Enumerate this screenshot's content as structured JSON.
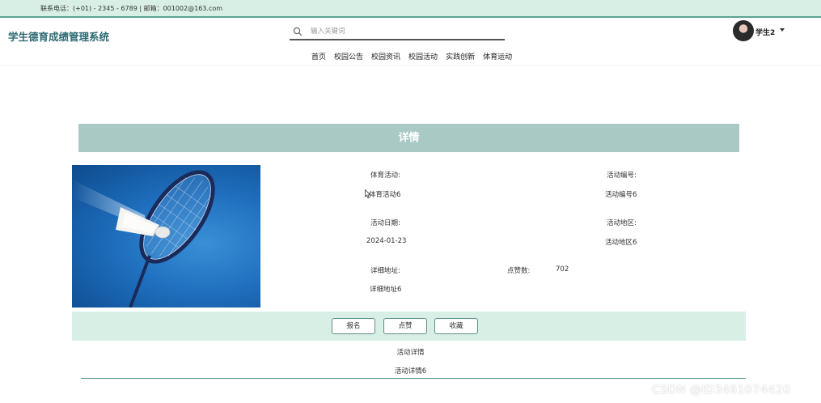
{
  "topbar": {
    "contact": "联系电话：(+01) - 2345 - 6789 | 邮箱：001002@163.com"
  },
  "header": {
    "site_title": "学生德育成绩管理系统",
    "search_placeholder": "输入关键词",
    "user_name": "学生2"
  },
  "nav": {
    "items": [
      "首页",
      "校园公告",
      "校园资讯",
      "校园活动",
      "实践创新",
      "体育运动"
    ]
  },
  "detail": {
    "title": "详情",
    "fields": {
      "sport_activity_label": "体育活动:",
      "sport_activity_value": "体育活动6",
      "activity_no_label": "活动编号:",
      "activity_no_value": "活动编号6",
      "activity_date_label": "活动日期:",
      "activity_date_value": "2024-01-23",
      "activity_area_label": "活动地区:",
      "activity_area_value": "活动地区6",
      "address_label": "详细地址:",
      "address_value": "详细地址6",
      "likes_label": "点赞数:",
      "likes_value": "702"
    },
    "buttons": {
      "signup": "报名",
      "like": "点赞",
      "favorite": "收藏"
    },
    "description_label": "活动详情",
    "description_value": "活动详情6"
  },
  "watermark": "CSDN @ID3461074420",
  "colors": {
    "topbar_bg": "#d8efe6",
    "accent": "#5aa590",
    "title_bar": "#a9c9c5",
    "site_title": "#2d6a74"
  },
  "icons": [
    "search-icon",
    "chevron-down-icon",
    "badminton-photo"
  ]
}
